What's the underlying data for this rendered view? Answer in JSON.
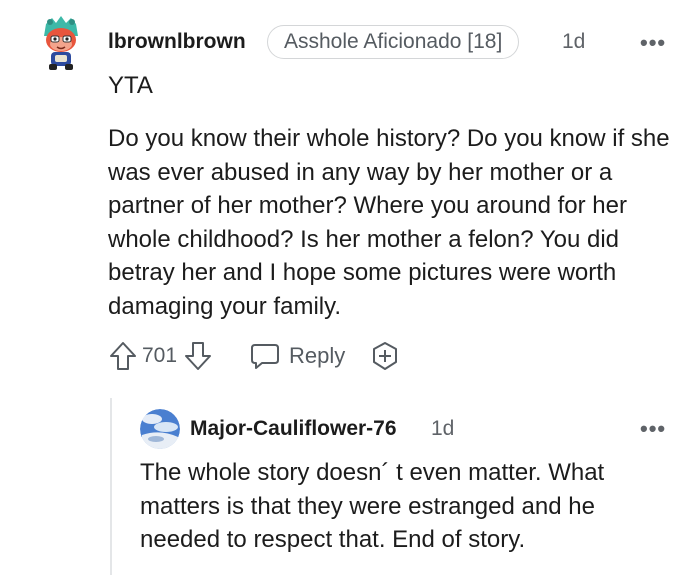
{
  "comment": {
    "username": "lbrownlbrown",
    "flair": "Asshole Aficionado [18]",
    "time": "1d",
    "more": "•••",
    "short_text": "YTA",
    "body": "Do you know their whole history? Do you know if she was ever abused in any way by her mother or a partner of her mother? Where you around for her whole childhood? Is her mother a felon? You did betray her and I hope some pictures were worth damaging your family.",
    "votes": "701",
    "reply_label": "Reply",
    "icons": [
      "upvote-icon",
      "downvote-icon",
      "comment-icon",
      "award-icon"
    ]
  },
  "reply": {
    "username": "Major-Cauliflower-76",
    "time": "1d",
    "more": "•••",
    "body": "The whole story doesn´ t even matter. What matters is that they were estranged and he needed to respect that. End of story."
  },
  "colors": {
    "text": "#1c1c1c",
    "muted": "#555b61",
    "border": "#d4d6d8"
  }
}
